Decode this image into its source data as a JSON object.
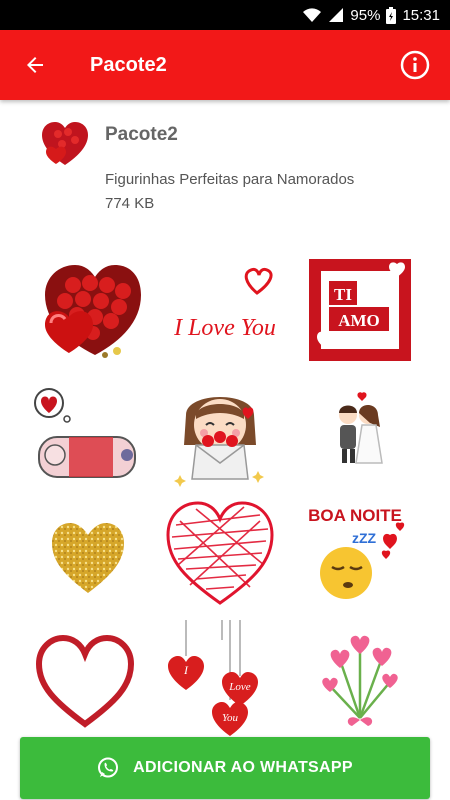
{
  "status_bar": {
    "battery": "95%",
    "time": "15:31"
  },
  "app_bar": {
    "title": "Pacote2"
  },
  "pack": {
    "name": "Pacote2",
    "description": "Figurinhas Perfeitas para Namorados",
    "size": "774 KB"
  },
  "stickers": {
    "love_you_text": "I Love You",
    "ti_amo_line1": "TI",
    "ti_amo_line2": "AMO",
    "boa_noite_text": "BOA NOITE",
    "zzz_text": "zZZ",
    "hang_heart1": "I",
    "hang_heart2": "Love",
    "hang_heart3": "You"
  },
  "footer": {
    "add_label": "ADICIONAR AO WHATSAPP"
  },
  "colors": {
    "app_bar": "#f21818",
    "add_button": "#3cbb3c",
    "status_bar": "#000000"
  }
}
